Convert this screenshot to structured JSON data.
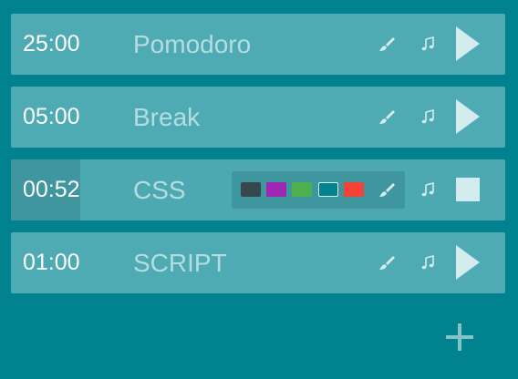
{
  "timers": [
    {
      "time": "25:00",
      "name": "Pomodoro",
      "state": "idle",
      "action_icon": "play-icon"
    },
    {
      "time": "05:00",
      "name": "Break",
      "state": "idle",
      "action_icon": "play-icon"
    },
    {
      "time": "00:52",
      "name": "CSS",
      "state": "running",
      "action_icon": "stop-icon",
      "progress_fraction": 0.14
    },
    {
      "time": "01:00",
      "name": "SCRIPT",
      "state": "idle",
      "action_icon": "play-icon"
    }
  ],
  "color_swatches": [
    {
      "name": "dark-gray",
      "color": "#37474f",
      "selected": false
    },
    {
      "name": "purple",
      "color": "#9c27b0",
      "selected": false
    },
    {
      "name": "green",
      "color": "#4caf50",
      "selected": false
    },
    {
      "name": "teal",
      "color": "#00838f",
      "selected": true
    },
    {
      "name": "red",
      "color": "#f44336",
      "selected": false
    }
  ],
  "colors": {
    "background": "#00838f",
    "row": "#4fabb3",
    "progress": "#3f969e",
    "name_text": "#b4dde1",
    "time_text": "#ffffff",
    "icon": "#d4ecee"
  },
  "icons": {
    "brush": "brush-icon",
    "music": "music-note-icon",
    "play": "play-icon",
    "stop": "stop-icon",
    "add": "plus-icon"
  }
}
